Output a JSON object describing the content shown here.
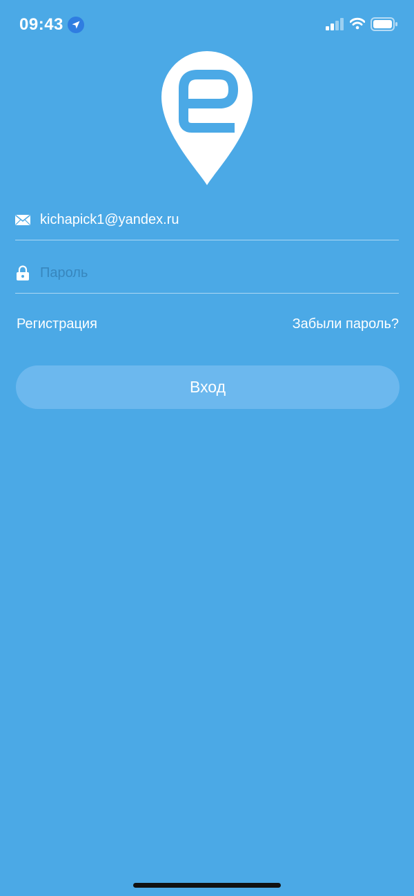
{
  "status_bar": {
    "time": "09:43",
    "icons": [
      "location-arrow-icon",
      "cellular-signal-icon",
      "wifi-icon",
      "battery-icon"
    ]
  },
  "logo": {
    "icon": "e-map-pin-logo"
  },
  "login_form": {
    "email": {
      "value": "kichapick1@yandex.ru",
      "icon": "envelope-icon"
    },
    "password": {
      "value": "",
      "placeholder": "Пароль",
      "icon": "lock-icon"
    },
    "register_link": "Регистрация",
    "forgot_password_link": "Забыли пароль?",
    "login_button": "Вход"
  },
  "colors": {
    "background": "#4ba9e6",
    "button": "#6cb8ee",
    "text": "#ffffff",
    "location_badge": "#2f7de1"
  }
}
